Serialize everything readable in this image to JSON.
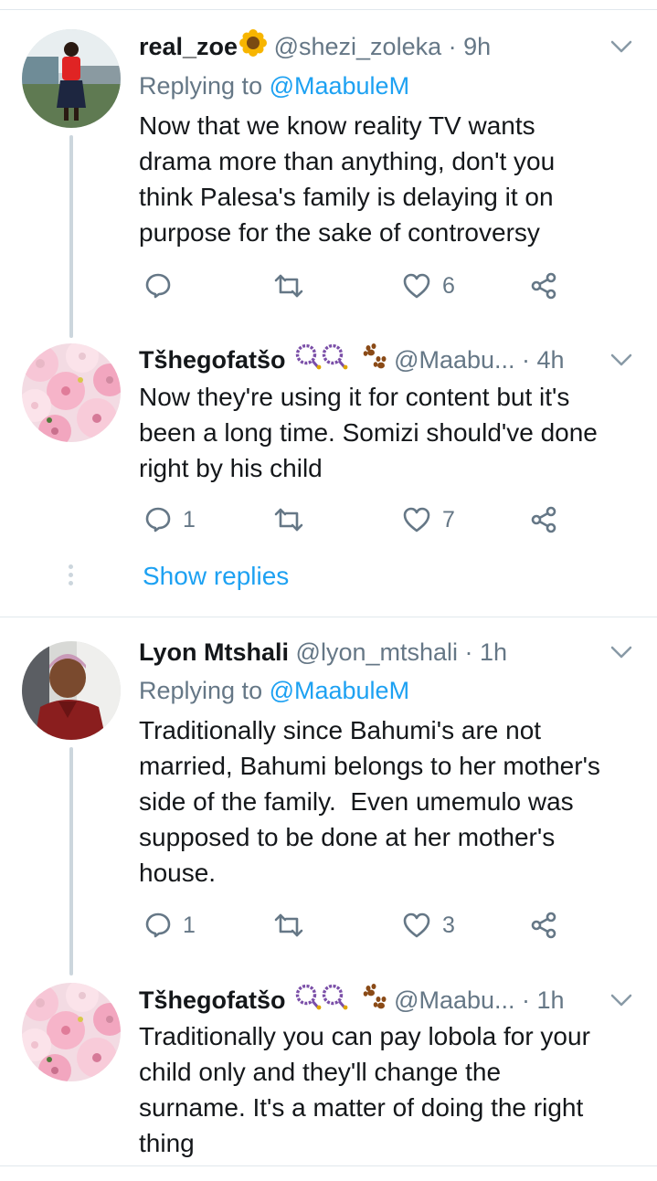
{
  "tweets": [
    {
      "name": "real_zoe",
      "name_emoji": "sunflower",
      "handle": "@shezi_zoleka",
      "time": "· 9h",
      "replying_prefix": "Replying to ",
      "replying_to": "@MaabuleM",
      "text": "Now that we know reality TV wants\ndrama more than anything, don't you\nthink Palesa's family is delaying it on\npurpose for the sake of controversy",
      "replies": "",
      "retweets": "",
      "likes": "6"
    },
    {
      "name": "Tšhegofatšo",
      "name_emoji": "rosary-rosary-paw",
      "handle": "@Maabu...",
      "time": "· 4h",
      "text": "Now they're using it for content but it's\nbeen a long time. Somizi should've done\nright by his child",
      "replies": "1",
      "retweets": "",
      "likes": "7"
    },
    {
      "name": "Lyon Mtshali",
      "handle": "@lyon_mtshali",
      "time": "· 1h",
      "replying_prefix": "Replying to ",
      "replying_to": "@MaabuleM",
      "text": "Traditionally since Bahumi's are not\nmarried, Bahumi belongs to her mother's\nside of the family.  Even umemulo was\nsupposed to be done at her mother's\nhouse.",
      "replies": "1",
      "retweets": "",
      "likes": "3"
    },
    {
      "name": "Tšhegofatšo",
      "name_emoji": "rosary-rosary-paw",
      "handle": "@Maabu...",
      "time": "· 1h",
      "text": "Traditionally you can pay lobola for your\nchild only and they'll change the\nsurname. It's a matter of doing the right\nthing"
    }
  ],
  "show_replies": "Show replies",
  "colors": {
    "link": "#1da1f2",
    "muted": "#657786",
    "text": "#14171a",
    "divider": "#e1e8ed",
    "thread": "#ccd6dd"
  }
}
